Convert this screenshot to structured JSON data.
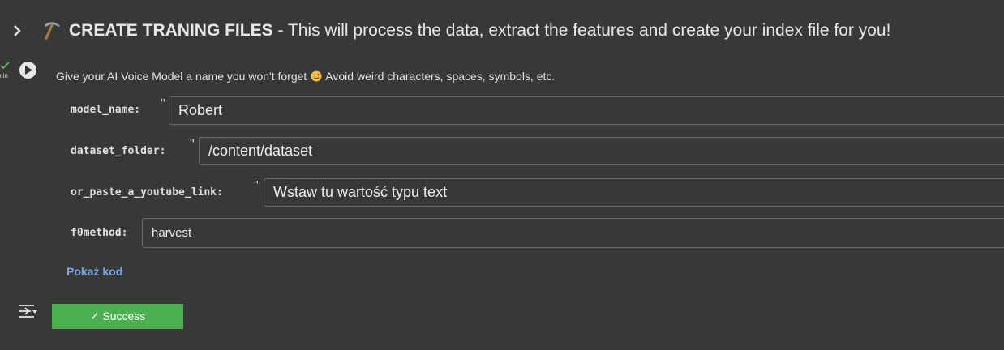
{
  "header": {
    "title_bold": "CREATE TRANING FILES",
    "title_rest": " - This will process the data, extract the features and create your index file for you!",
    "icon": "pick-icon"
  },
  "gutter": {
    "time": "min",
    "status_icon": "check-icon",
    "run_icon": "play-icon"
  },
  "description": {
    "before_emoji": "Give your AI Voice Model a name you won't forget ",
    "after_emoji": " Avoid weird characters, spaces, symbols, etc."
  },
  "form": {
    "model_name": {
      "label": "model_name:",
      "quote": "\"",
      "value": "Robert"
    },
    "dataset_folder": {
      "label": "dataset_folder:",
      "quote": "\"",
      "value": "/content/dataset"
    },
    "youtube_link": {
      "label": "or_paste_a_youtube_link:",
      "quote": "\"",
      "placeholder": "Wstaw tu wartość typu text"
    },
    "f0method": {
      "label": "f0method:",
      "value": "harvest"
    }
  },
  "show_code": "Pokaż kod",
  "output": {
    "success_label": "✓ Success",
    "success_color": "#4caf50",
    "output_icon": "output-settings-icon"
  },
  "colors": {
    "background": "#383838",
    "link": "#7ba7e6"
  }
}
